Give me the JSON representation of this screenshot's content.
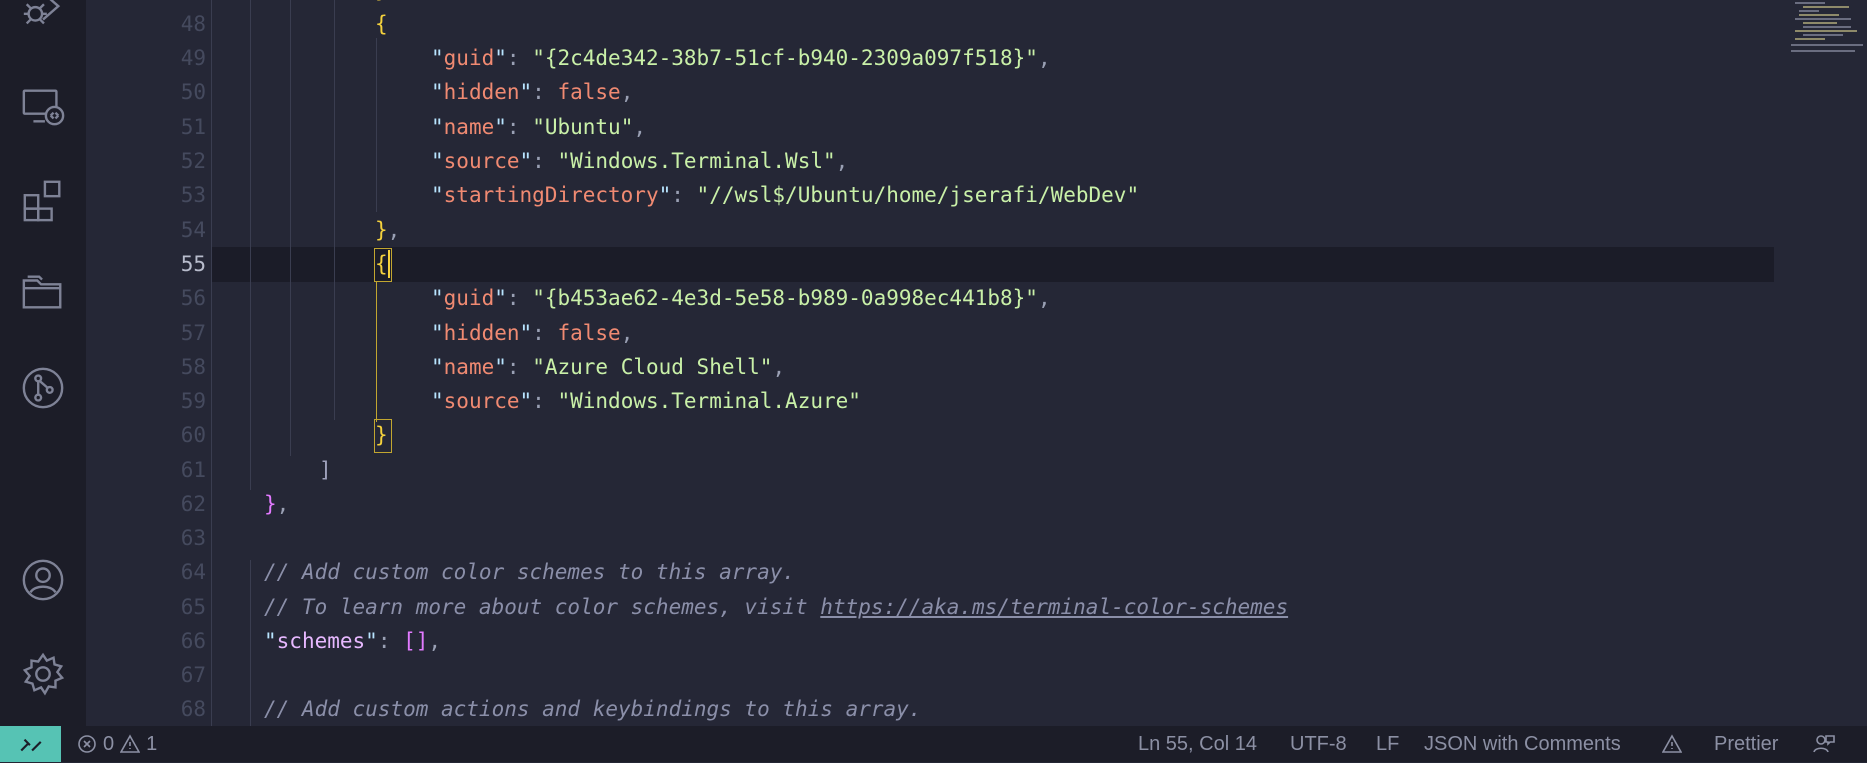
{
  "activity_bar": {
    "icons": [
      "run-debug-icon",
      "remote-explorer-icon",
      "extensions-icon",
      "folder-icon",
      "source-control-icon",
      "account-icon",
      "settings-gear-icon"
    ]
  },
  "editor": {
    "line_numbers": [
      "48",
      "49",
      "50",
      "51",
      "52",
      "53",
      "54",
      "55",
      "56",
      "57",
      "58",
      "59",
      "60",
      "61",
      "62",
      "63",
      "64",
      "65",
      "66",
      "67",
      "68"
    ],
    "active_line": "55",
    "profile1": {
      "guid_key": "guid",
      "guid_value": "{2c4de342-38b7-51cf-b940-2309a097f518}",
      "hidden_key": "hidden",
      "hidden_value": "false",
      "name_key": "name",
      "name_value": "Ubuntu",
      "source_key": "source",
      "source_value": "Windows.Terminal.Wsl",
      "dir_key": "startingDirectory",
      "dir_value": "//wsl$/Ubuntu/home/jserafi/WebDev"
    },
    "profile2": {
      "guid_key": "guid",
      "guid_value": "{b453ae62-4e3d-5e58-b989-0a998ec441b8}",
      "hidden_key": "hidden",
      "hidden_value": "false",
      "name_key": "name",
      "name_value": "Azure Cloud Shell",
      "source_key": "source",
      "source_value": "Windows.Terminal.Azure"
    },
    "comment_schemes_1": "// Add custom color schemes to this array.",
    "comment_schemes_2_prefix": "// To learn more about color schemes, visit ",
    "comment_schemes_2_link": "https://aka.ms/terminal-color-schemes",
    "schemes_key": "schemes",
    "comment_actions": "// Add custom actions and keybindings to this array."
  },
  "status_bar": {
    "errors": "0",
    "warnings": "1",
    "cursor_position": "Ln 55, Col 14",
    "encoding": "UTF-8",
    "eol": "LF",
    "language": "JSON with Comments",
    "formatter": "Prettier"
  },
  "colors": {
    "accent": "#56c3b4",
    "key": "#f08a72",
    "string": "#c9f0a8",
    "brace_yellow": "#f5d23d",
    "brace_magenta": "#e27aff"
  }
}
